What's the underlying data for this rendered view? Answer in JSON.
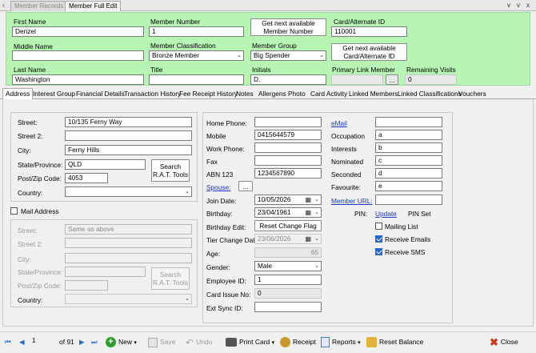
{
  "window_tabs": [
    "Member Records",
    "Member Full Edit"
  ],
  "window_controls": [
    "v",
    "v",
    "x"
  ],
  "header": {
    "first_name": {
      "label": "First Name",
      "value": "Denzel"
    },
    "member_number": {
      "label": "Member Number",
      "value": "1"
    },
    "get_member_button": "Get next available Member Number",
    "card_id": {
      "label": "Card/Alternate ID",
      "value": "110001"
    },
    "middle_name": {
      "label": "Middle Name",
      "value": ""
    },
    "member_classification": {
      "label": "Member Classification",
      "value": "Bronze Member"
    },
    "member_group": {
      "label": "Member Group",
      "value": "Big Spender"
    },
    "get_card_button": "Get next available Card/Alternate ID",
    "last_name": {
      "label": "Last Name",
      "value": "Washington"
    },
    "title": {
      "label": "Title",
      "value": ""
    },
    "initials": {
      "label": "Initials",
      "value": "D."
    },
    "primary_link": {
      "label": "Primary Link Member",
      "value": "",
      "button": "..."
    },
    "remaining_visits": {
      "label": "Remaining Visits",
      "value": "0"
    }
  },
  "tabs": [
    "Address",
    "Interest Group",
    "Financial Details",
    "Transaction History",
    "Fee Receipt History",
    "Notes",
    "Allergens",
    "Photo",
    "Card Activity",
    "Linked Members",
    "Linked Classifications",
    "Vouchers"
  ],
  "address": {
    "street_label": "Street:",
    "street": "10/135 Ferny Way",
    "street2_label": "Street 2:",
    "street2": "",
    "city_label": "City:",
    "city": "Ferny Hills",
    "state_label": "State/Province:",
    "state": "QLD",
    "post_label": "Post/Zip Code:",
    "post": "4053",
    "country_label": "Country:",
    "country": "",
    "search_button": "Search R.A.T. Tools"
  },
  "mail": {
    "checkbox_label": "Mail Address",
    "street_label": "Street:",
    "street": "Same as above",
    "street2_label": "Street 2:",
    "city_label": "City:",
    "state_label": "State/Province:",
    "post_label": "Post/Zip Code:",
    "country_label": "Country:",
    "search_button": "Search R.A.T. Tools"
  },
  "contact": {
    "home_label": "Home Phone:",
    "home": "",
    "mobile_label": "Mobile",
    "mobile": "0415644579",
    "work_label": "Work Phone:",
    "work": "",
    "fax_label": "Fax",
    "fax": "",
    "abn_label": "ABN 123",
    "abn": "1234567890",
    "spouse_label": "Spouse:",
    "spouse_button": "...",
    "join_label": "Join Date:",
    "join": "10/05/2026",
    "birthday_label": "Birthday:",
    "birthday": "23/04/1961",
    "birthday_edit_label": "Birthday Edit:",
    "reset_button": "Reset Change Flag",
    "tier_label": "Tier Change Date:",
    "tier": "23/06/2026",
    "age_label": "Age:",
    "age": "65",
    "gender_label": "Gender:",
    "gender": "Male",
    "employee_label": "Employee ID:",
    "employee": "1",
    "card_issue_label": "Card Issue No:",
    "card_issue": "0",
    "ext_sync_label": "Ext Sync ID:",
    "ext_sync": ""
  },
  "right": {
    "email_label": "eMail",
    "email": "",
    "occupation_label": "Occupation",
    "occupation": "a",
    "interests_label": "Interests",
    "interests": "b",
    "nominated_label": "Nominated",
    "nominated": "c",
    "seconded_label": "Seconded",
    "seconded": "d",
    "favourite_label": "Favourite:",
    "favourite": "e",
    "member_url_label": "Member URL:",
    "member_url": "",
    "pin_label": "PIN:",
    "pin_update": "Update",
    "pin_status": "PIN Set",
    "mailing_list": "Mailing List",
    "receive_emails": "Receive Emails",
    "receive_sms": "Receive SMS"
  },
  "toolbar": {
    "record": "1",
    "of_label": "of 91",
    "new": "New",
    "save": "Save",
    "undo": "Undo",
    "print_card": "Print Card",
    "receipt": "Receipt",
    "reports": "Reports",
    "reset_balance": "Reset Balance",
    "close": "Close"
  }
}
